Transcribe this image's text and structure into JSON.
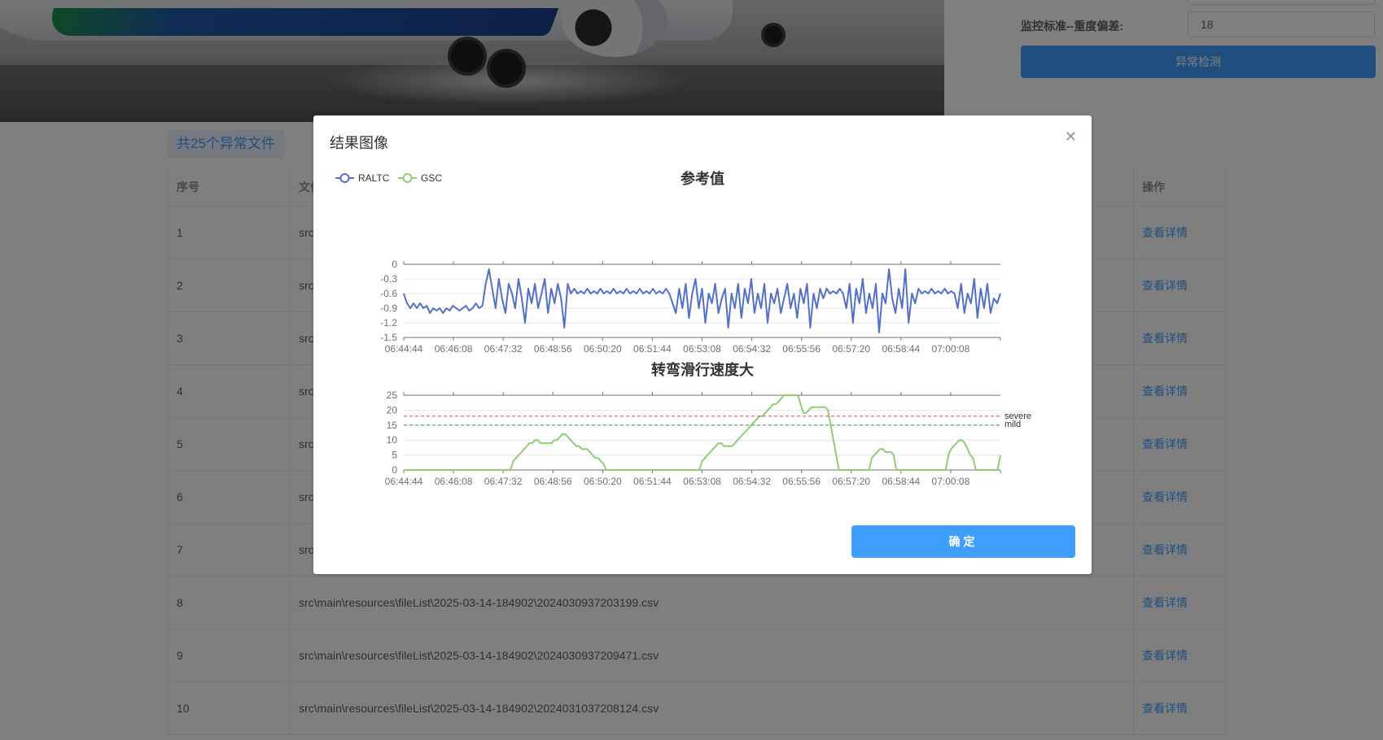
{
  "side_form": {
    "std_label": "监控标准--重度偏差:",
    "std_value": "18",
    "detect_button": "异常检测"
  },
  "count_tag": "共25个异常文件",
  "table": {
    "headers": [
      "序号",
      "文件",
      "操作"
    ],
    "rows": [
      {
        "index": "1",
        "file": "src",
        "action": "查看详情"
      },
      {
        "index": "2",
        "file": "src",
        "action": "查看详情"
      },
      {
        "index": "3",
        "file": "src",
        "action": "查看详情"
      },
      {
        "index": "4",
        "file": "src",
        "action": "查看详情"
      },
      {
        "index": "5",
        "file": "src",
        "action": "查看详情"
      },
      {
        "index": "6",
        "file": "src",
        "action": "查看详情"
      },
      {
        "index": "7",
        "file": "src",
        "action": "查看详情"
      },
      {
        "index": "8",
        "file": "src\\main\\resources\\fileList\\2025-03-14-184902\\2024030937203199.csv",
        "action": "查看详情"
      },
      {
        "index": "9",
        "file": "src\\main\\resources\\fileList\\2025-03-14-184902\\2024030937209471.csv",
        "action": "查看详情"
      },
      {
        "index": "10",
        "file": "src\\main\\resources\\fileList\\2025-03-14-184902\\2024031037208124.csv",
        "action": "查看详情"
      }
    ]
  },
  "dialog": {
    "title": "结果图像",
    "close_icon": "close-icon",
    "confirm_button": "确定"
  },
  "chart_data": [
    {
      "type": "line",
      "title": "参考值",
      "legend": [
        "RALTC",
        "GSC"
      ],
      "legend_placement": "top-left",
      "series": [
        {
          "name": "RALTC",
          "color": "#5470c6",
          "values": [
            -0.6,
            -0.8,
            -0.9,
            -0.8,
            -0.9,
            -0.8,
            -0.9,
            -0.85,
            -1.0,
            -0.9,
            -0.95,
            -0.9,
            -1.0,
            -0.9,
            -0.95,
            -0.85,
            -0.9,
            -0.95,
            -0.9,
            -0.85,
            -0.95,
            -0.9,
            -0.8,
            -0.9,
            -0.85,
            -0.4,
            -0.1,
            -0.5,
            -0.9,
            -0.3,
            -0.7,
            -1.0,
            -0.4,
            -0.6,
            -0.9,
            -0.3,
            -0.7,
            -1.2,
            -0.5,
            -0.8,
            -0.4,
            -0.9,
            -0.6,
            -0.3,
            -1.0,
            -0.5,
            -0.8,
            -0.4,
            -0.7,
            -1.3,
            -0.4,
            -0.6,
            -0.5,
            -0.6,
            -0.55,
            -0.6,
            -0.5,
            -0.6,
            -0.55,
            -0.6,
            -0.5,
            -0.6,
            -0.55,
            -0.6,
            -0.5,
            -0.6,
            -0.55,
            -0.6,
            -0.5,
            -0.6,
            -0.55,
            -0.6,
            -0.5,
            -0.6,
            -0.55,
            -0.6,
            -0.5,
            -0.6,
            -0.55,
            -0.6,
            -0.5,
            -0.6,
            -0.8,
            -1.0,
            -0.5,
            -0.9,
            -0.4,
            -1.1,
            -0.6,
            -0.3,
            -0.9,
            -0.5,
            -1.2,
            -0.6,
            -0.8,
            -0.4,
            -1.0,
            -0.7,
            -0.5,
            -1.3,
            -0.6,
            -0.9,
            -0.4,
            -1.1,
            -0.5,
            -0.8,
            -0.3,
            -1.0,
            -0.6,
            -0.9,
            -0.4,
            -1.2,
            -0.6,
            -0.8,
            -0.5,
            -1.0,
            -0.7,
            -0.4,
            -0.9,
            -0.6,
            -1.1,
            -0.5,
            -0.8,
            -0.4,
            -1.3,
            -0.6,
            -0.9,
            -0.5,
            -0.7,
            -0.5,
            -0.6,
            -0.55,
            -0.6,
            -0.5,
            -0.6,
            -0.9,
            -0.4,
            -1.2,
            -0.5,
            -0.8,
            -0.3,
            -1.0,
            -0.6,
            -0.9,
            -0.4,
            -1.4,
            -0.6,
            -0.8,
            -0.1,
            -0.7,
            -1.0,
            -0.5,
            -0.9,
            -0.1,
            -1.2,
            -0.6,
            -0.8,
            -0.5,
            -0.6,
            -0.55,
            -0.6,
            -0.5,
            -0.6,
            -0.55,
            -0.6,
            -0.5,
            -0.6,
            -0.55,
            -0.6,
            -0.9,
            -0.4,
            -1.0,
            -0.6,
            -0.8,
            -0.3,
            -1.1,
            -0.5,
            -0.9,
            -0.4,
            -1.0,
            -0.7,
            -0.8,
            -0.6
          ]
        },
        {
          "name": "GSC",
          "color": "#91cc75",
          "values": []
        }
      ],
      "x_ticks": [
        "06:44:44",
        "06:46:08",
        "06:47:32",
        "06:48:56",
        "06:50:20",
        "06:51:44",
        "06:53:08",
        "06:54:32",
        "06:55:56",
        "06:57:20",
        "06:58:44",
        "07:00:08"
      ],
      "y_ticks": [
        "0",
        "-0.3",
        "-0.6",
        "-0.9",
        "-1.2",
        "-1.5"
      ],
      "ylim": [
        -1.5,
        0
      ],
      "grid": true
    },
    {
      "type": "line",
      "title": "转弯滑行速度大",
      "series": [
        {
          "name": "GSC",
          "color": "#91cc75",
          "values": [
            0,
            0,
            0,
            0,
            0,
            0,
            0,
            0,
            0,
            0,
            0,
            0,
            0,
            0,
            0,
            0,
            0,
            0,
            0,
            0,
            0,
            0,
            0,
            0,
            0,
            0,
            0,
            0,
            0,
            0,
            0,
            0,
            0,
            0,
            0,
            0,
            0,
            0,
            0,
            0,
            3,
            4,
            5,
            6,
            7,
            8,
            9,
            9,
            10,
            10,
            9,
            9,
            9,
            9,
            9,
            10,
            10,
            11,
            12,
            12,
            11,
            10,
            9,
            8,
            8,
            7,
            7,
            7,
            6,
            5,
            4,
            4,
            3,
            2,
            0,
            0,
            0,
            0,
            0,
            0,
            0,
            0,
            0,
            0,
            0,
            0,
            0,
            0,
            0,
            0,
            0,
            0,
            0,
            0,
            0,
            0,
            0,
            0,
            0,
            0,
            0,
            0,
            0,
            0,
            0,
            0,
            0,
            0,
            0,
            3,
            4,
            5,
            6,
            7,
            8,
            9,
            9,
            8,
            8,
            8,
            8,
            9,
            10,
            11,
            12,
            13,
            14,
            15,
            16,
            17,
            18,
            18,
            19,
            20,
            21,
            22,
            22,
            23,
            24,
            25,
            25,
            25,
            25,
            25,
            25,
            22,
            19,
            19,
            20,
            21,
            21,
            21,
            21,
            21,
            21,
            20,
            15,
            10,
            5,
            0,
            0,
            0,
            0,
            0,
            0,
            0,
            0,
            0,
            0,
            0,
            0,
            4,
            5,
            6,
            7,
            7,
            6,
            6,
            6,
            5,
            0,
            0,
            0,
            0,
            0,
            0,
            0,
            0,
            0,
            0,
            0,
            0,
            0,
            0,
            0,
            0,
            0,
            0,
            0,
            5,
            7,
            8,
            9,
            10,
            10,
            9,
            7,
            5,
            4,
            0,
            0,
            0,
            0,
            0,
            0,
            0,
            0,
            0,
            5
          ]
        }
      ],
      "thresholds": [
        {
          "label": "severe",
          "value": 18,
          "color": "#ee6666"
        },
        {
          "label": "mild",
          "value": 15,
          "color": "#3ba272"
        }
      ],
      "x_ticks": [
        "06:44:44",
        "06:46:08",
        "06:47:32",
        "06:48:56",
        "06:50:20",
        "06:51:44",
        "06:53:08",
        "06:54:32",
        "06:55:56",
        "06:57:20",
        "06:58:44",
        "07:00:08"
      ],
      "y_ticks": [
        "25",
        "20",
        "15",
        "10",
        "5",
        "0"
      ],
      "ylim": [
        0,
        25
      ],
      "grid": true
    }
  ]
}
